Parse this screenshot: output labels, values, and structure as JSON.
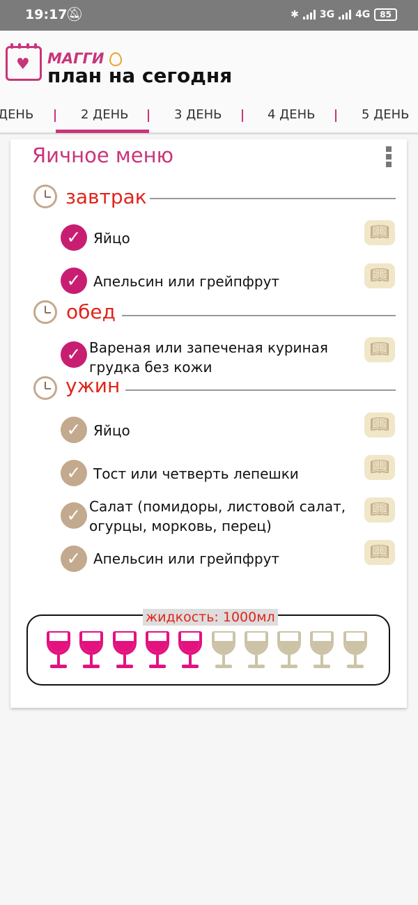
{
  "status_bar": {
    "time": "19:17",
    "bell_icon": "bell-off-icon",
    "bluetooth_icon": "bluetooth-icon",
    "network1": "3G",
    "network2": "4G",
    "battery": "85"
  },
  "app": {
    "brand": "МАГГИ",
    "title": "план на сегодня"
  },
  "tabs": [
    {
      "label": "ДЕНЬ"
    },
    {
      "label": "2 ДЕНЬ",
      "selected": true
    },
    {
      "label": "3 ДЕНЬ"
    },
    {
      "label": "4 ДЕНЬ"
    },
    {
      "label": "5 ДЕНЬ"
    }
  ],
  "menu": {
    "title": "Яичное меню",
    "sections": [
      {
        "title": "завтрак",
        "items": [
          {
            "text": "Яйцо",
            "done": true
          },
          {
            "text": "Апельсин или грейпфрут",
            "done": true
          }
        ]
      },
      {
        "title": "обед",
        "items": [
          {
            "text": "Вареная или запеченая куриная грудка без кожи",
            "done": true
          }
        ]
      },
      {
        "title": "ужин",
        "items": [
          {
            "text": "Яйцо",
            "done": false
          },
          {
            "text": "Тост или четверть лепешки",
            "done": false
          },
          {
            "text": "Салат (помидоры, листовой салат, огурцы, морковь, перец)",
            "done": false
          },
          {
            "text": "Апельсин или грейпфрут",
            "done": false
          }
        ]
      }
    ]
  },
  "liquid": {
    "label": "жидкость: 1000мл",
    "glasses_total": 10,
    "glasses_filled": 5,
    "full_color": "#e3127f",
    "empty_color": "#ccc3a6"
  },
  "colors": {
    "accent": "#c8357a",
    "section": "#e0241b",
    "done": "#c81e72",
    "todo": "#c3a98d"
  }
}
